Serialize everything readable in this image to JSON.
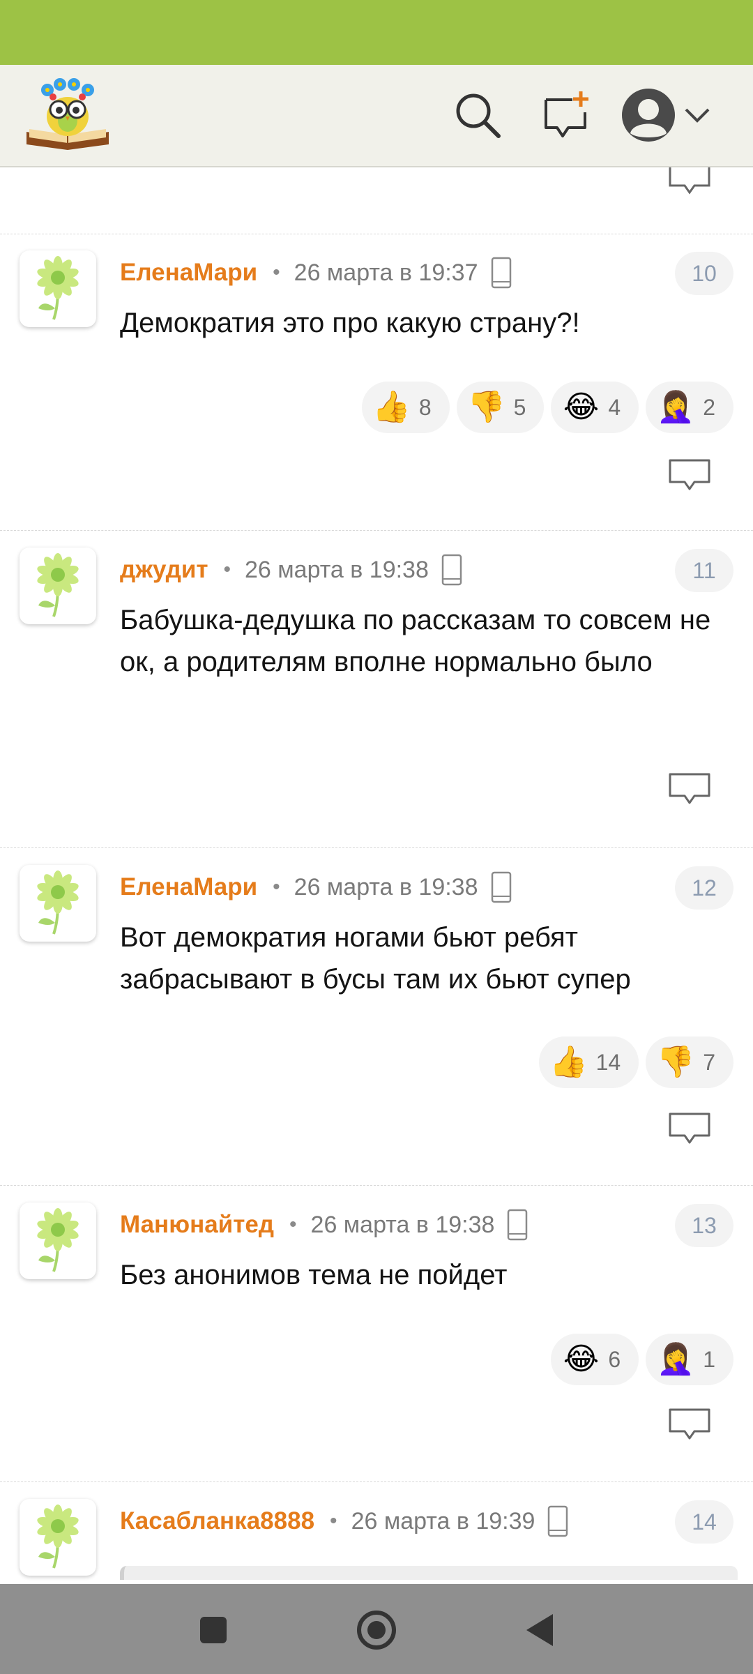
{
  "comments": [
    {
      "author": "ЕленаМари",
      "date": "26 марта в 19:37",
      "number": "10",
      "text": "Демократия это про какую страну?!",
      "reactions": [
        {
          "emoji": "👍",
          "count": "8"
        },
        {
          "emoji": "👎",
          "count": "5"
        },
        {
          "emoji": "😂",
          "count": "4"
        },
        {
          "emoji": "🤦‍♀️",
          "count": "2"
        }
      ]
    },
    {
      "author": "джудит",
      "date": "26 марта в 19:38",
      "number": "11",
      "text": "Бабушка-дедушка по рассказам то совсем не ок, а родителям вполне нормально было",
      "reactions": []
    },
    {
      "author": "ЕленаМари",
      "date": "26 марта в 19:38",
      "number": "12",
      "text": "Вот демократия ногами бьют ребят забрасывают в бусы там их бьют супер",
      "reactions": [
        {
          "emoji": "👍",
          "count": "14"
        },
        {
          "emoji": "👎",
          "count": "7"
        }
      ]
    },
    {
      "author": "Манюнайтед",
      "date": "26 марта в 19:38",
      "number": "13",
      "text": "Без анонимов тема не пойдет",
      "reactions": [
        {
          "emoji": "😂",
          "count": "6"
        },
        {
          "emoji": "🤦‍♀️",
          "count": "1"
        }
      ]
    },
    {
      "author": "Касабланка8888",
      "date": "26 марта в 19:39",
      "number": "14",
      "text": "",
      "reactions": []
    }
  ],
  "meta_separator": "•",
  "icons": {
    "logo": "owl-book-logo-icon",
    "search": "search-icon",
    "new_post": "new-post-icon",
    "profile": "profile-avatar-icon",
    "dropdown": "chevron-down-icon",
    "device": "mobile-device-icon",
    "reply": "reply-bubble-icon",
    "avatar": "flower-avatar-icon",
    "nav_recent": "square-icon",
    "nav_home": "circle-home-icon",
    "nav_back": "triangle-back-icon"
  },
  "colors": {
    "status_bar": "#9dc245",
    "header_bg": "#f1f1ea",
    "author": "#e57c1b",
    "nav_bar": "#8f8f8f"
  }
}
